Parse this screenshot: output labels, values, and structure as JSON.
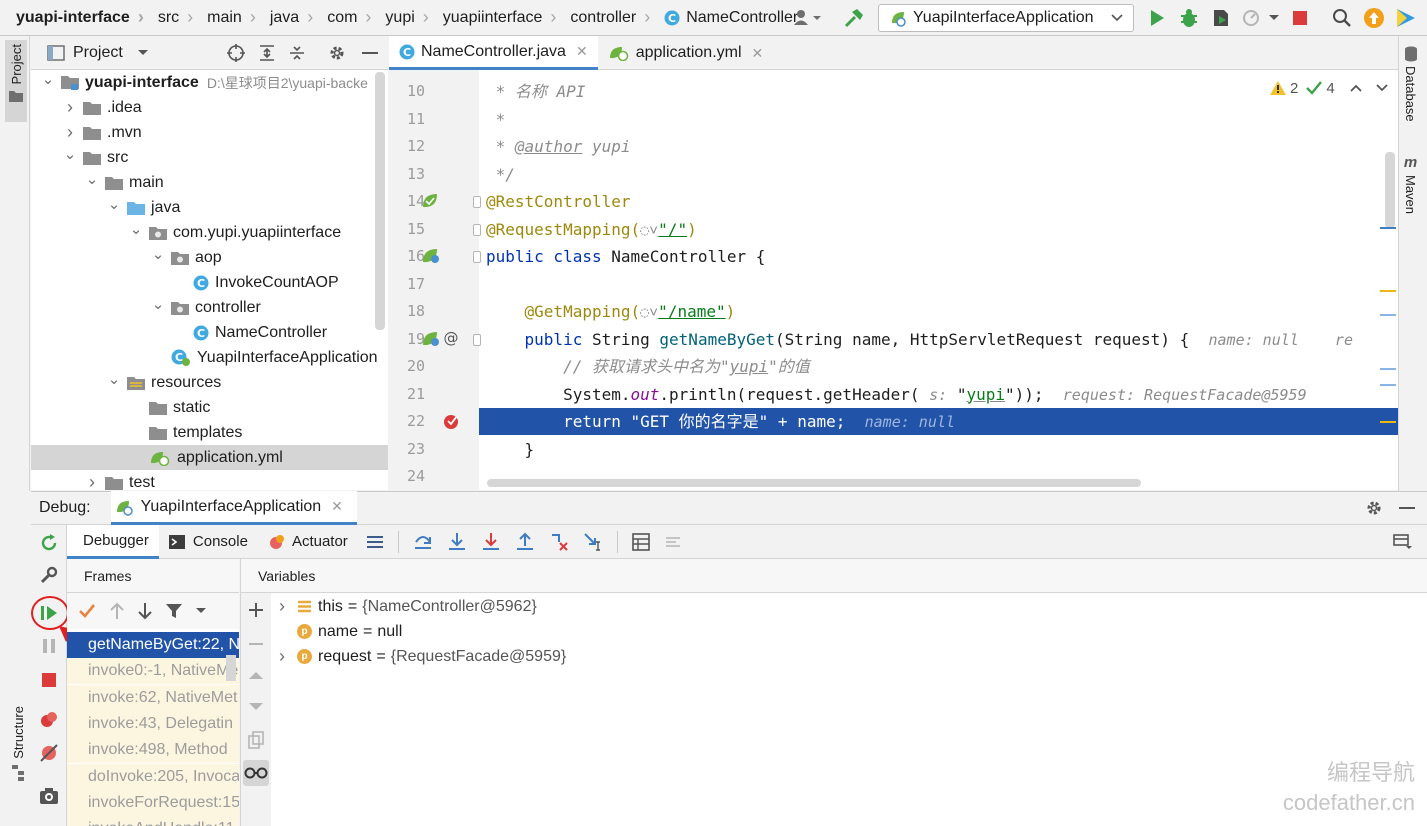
{
  "breadcrumb": [
    "yuapi-interface",
    "src",
    "main",
    "java",
    "com",
    "yupi",
    "yuapiinterface",
    "controller",
    "NameController"
  ],
  "run_config": {
    "label": "YuapiInterfaceApplication"
  },
  "left_stripe": {
    "project_tab": "Project",
    "structure_tab": "Structure"
  },
  "right_stripe": {
    "database_tab": "Database",
    "maven_tab": "Maven"
  },
  "project_panel": {
    "title": "Project",
    "tree": [
      {
        "label": "yuapi-interface",
        "path": "D:\\星球项目2\\yuapi-backe",
        "level": 0,
        "arrow": "down",
        "icon": "module"
      },
      {
        "label": ".idea",
        "level": 1,
        "arrow": "right",
        "icon": "folder"
      },
      {
        "label": ".mvn",
        "level": 1,
        "arrow": "right",
        "icon": "folder"
      },
      {
        "label": "src",
        "level": 1,
        "arrow": "down",
        "icon": "folder"
      },
      {
        "label": "main",
        "level": 2,
        "arrow": "down",
        "icon": "folder"
      },
      {
        "label": "java",
        "level": 3,
        "arrow": "down",
        "icon": "folder-blue"
      },
      {
        "label": "com.yupi.yuapiinterface",
        "level": 4,
        "arrow": "down",
        "icon": "package"
      },
      {
        "label": "aop",
        "level": 5,
        "arrow": "down",
        "icon": "package"
      },
      {
        "label": "InvokeCountAOP",
        "level": 6,
        "arrow": "",
        "icon": "class"
      },
      {
        "label": "controller",
        "level": 5,
        "arrow": "down",
        "icon": "package"
      },
      {
        "label": "NameController",
        "level": 6,
        "arrow": "",
        "icon": "class"
      },
      {
        "label": "YuapiInterfaceApplication",
        "level": 5,
        "arrow": "",
        "icon": "spring-class"
      },
      {
        "label": "resources",
        "level": 3,
        "arrow": "down",
        "icon": "resources"
      },
      {
        "label": "static",
        "level": 4,
        "arrow": "",
        "icon": "folder"
      },
      {
        "label": "templates",
        "level": 4,
        "arrow": "",
        "icon": "folder"
      },
      {
        "label": "application.yml",
        "level": 4,
        "arrow": "",
        "icon": "yml",
        "selected": true
      },
      {
        "label": "test",
        "level": 2,
        "arrow": "right",
        "icon": "folder"
      }
    ]
  },
  "editor": {
    "tabs": [
      {
        "label": "NameController.java",
        "active": true,
        "icon": "class"
      },
      {
        "label": "application.yml",
        "active": false,
        "icon": "yml"
      }
    ],
    "inspections": {
      "warnings": "2",
      "ok": "4"
    },
    "lines": [
      {
        "n": "10",
        "parts": [
          {
            "t": " * 名称 API",
            "c": "cm"
          }
        ]
      },
      {
        "n": "11",
        "parts": [
          {
            "t": " *",
            "c": "cm"
          }
        ]
      },
      {
        "n": "12",
        "parts": [
          {
            "t": " * ",
            "c": "cm"
          },
          {
            "t": "@author",
            "c": "cm-u"
          },
          {
            "t": " yupi",
            "c": "cm"
          }
        ]
      },
      {
        "n": "13",
        "parts": [
          {
            "t": " */",
            "c": "cm"
          }
        ]
      },
      {
        "n": "14",
        "parts": [
          {
            "t": "@RestController",
            "c": "an"
          }
        ]
      },
      {
        "n": "15",
        "parts": [
          {
            "t": "@RequestMapping(",
            "c": "an"
          },
          {
            "t": "◌˅",
            "c": "hint"
          },
          {
            "t": "\"/\"",
            "c": "st-u"
          },
          {
            "t": ")",
            "c": "an"
          }
        ]
      },
      {
        "n": "16",
        "parts": [
          {
            "t": "public class ",
            "c": "kw"
          },
          {
            "t": "NameController {",
            "c": ""
          }
        ]
      },
      {
        "n": "17",
        "parts": [
          {
            "t": "",
            "c": ""
          }
        ]
      },
      {
        "n": "18",
        "parts": [
          {
            "t": "    @GetMapping(",
            "c": "an"
          },
          {
            "t": "◌˅",
            "c": "hint"
          },
          {
            "t": "\"/name\"",
            "c": "st-u"
          },
          {
            "t": ")",
            "c": "an"
          }
        ]
      },
      {
        "n": "19",
        "parts": [
          {
            "t": "    public ",
            "c": "kw"
          },
          {
            "t": "String ",
            "c": ""
          },
          {
            "t": "getNameByGet",
            "c": "fn"
          },
          {
            "t": "(String name, HttpServletRequest request) {  ",
            "c": ""
          },
          {
            "t": "name: null    re",
            "c": "hint"
          }
        ]
      },
      {
        "n": "20",
        "parts": [
          {
            "t": "        // 获取请求头中名为\"",
            "c": "cm"
          },
          {
            "t": "yupi",
            "c": "cm-u"
          },
          {
            "t": "\"的值",
            "c": "cm"
          }
        ]
      },
      {
        "n": "21",
        "parts": [
          {
            "t": "        System.",
            "c": ""
          },
          {
            "t": "out",
            "c": "it"
          },
          {
            "t": ".println(request.getHeader( ",
            "c": ""
          },
          {
            "t": "s:",
            "c": "hint"
          },
          {
            "t": " \"",
            "c": ""
          },
          {
            "t": "yupi",
            "c": "st-u2"
          },
          {
            "t": "\"));  ",
            "c": ""
          },
          {
            "t": "request: RequestFacade@5959",
            "c": "hint"
          }
        ]
      },
      {
        "n": "22",
        "parts": [
          {
            "t": "        return \"GET 你的名字是\" + name;  ",
            "c": "w"
          },
          {
            "t": "name: null",
            "c": "hintw"
          }
        ],
        "highlight": true
      },
      {
        "n": "23",
        "parts": [
          {
            "t": "    }",
            "c": ""
          }
        ]
      },
      {
        "n": "24",
        "parts": [
          {
            "t": "",
            "c": ""
          }
        ]
      }
    ]
  },
  "debug": {
    "label": "Debug:",
    "session": "YuapiInterfaceApplication",
    "tabs": [
      "Debugger",
      "Console",
      "Actuator"
    ],
    "frames_title": "Frames",
    "variables_title": "Variables",
    "frames": [
      {
        "label": "getNameByGet:22, N",
        "selected": true
      },
      {
        "label": "invoke0:-1, NativeMe"
      },
      {
        "label": "invoke:62, NativeMet"
      },
      {
        "label": "invoke:43, Delegatin"
      },
      {
        "label": "invoke:498, Method"
      },
      {
        "label": "doInvoke:205, Invoca"
      },
      {
        "label": "invokeForRequest:15"
      },
      {
        "label": "invokeAndHandle:11"
      }
    ],
    "variables": [
      {
        "name": "this",
        "value": "{NameController@5962}",
        "icon": "this",
        "expandable": true
      },
      {
        "name": "name",
        "value": "null",
        "icon": "p",
        "expandable": false
      },
      {
        "name": "request",
        "value": "{RequestFacade@5959}",
        "icon": "p",
        "expandable": true
      }
    ]
  },
  "watermark": {
    "line1": "编程导航",
    "line2": "codefather.cn"
  },
  "colors": {
    "accent": "#4083c9",
    "selection": "#2154a8",
    "run_green": "#3ca34b",
    "stop_red": "#db3b3b",
    "annotation": "#9e880d",
    "annotation_arrow": "#e02020"
  }
}
